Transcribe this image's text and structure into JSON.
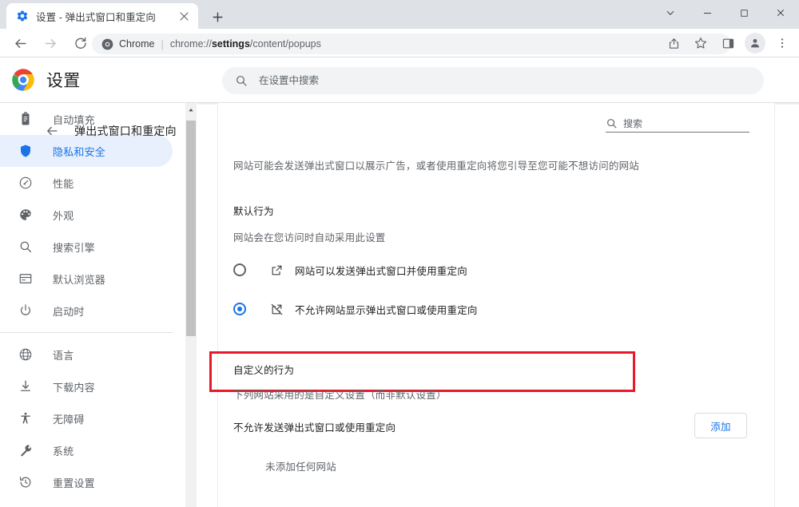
{
  "window": {
    "controls": [
      {
        "name": "tab-search-button",
        "glyph": "chevron-down-icon"
      },
      {
        "name": "minimize-button",
        "glyph": "minimize-icon"
      },
      {
        "name": "maximize-button",
        "glyph": "maximize-icon"
      },
      {
        "name": "close-button",
        "glyph": "close-icon"
      }
    ]
  },
  "tabstrip": {
    "tab": {
      "title": "设置 - 弹出式窗口和重定向",
      "favicon": "settings-gear-icon",
      "close_label": "×"
    },
    "new_tab_label": "+"
  },
  "toolbar": {
    "back_label": "←",
    "forward_label": "→",
    "reload_label": "⟳",
    "omnibox": {
      "icon": "chrome-icon",
      "scheme_label": "Chrome",
      "separator": "|",
      "url_prefix": "chrome://",
      "url_bold": "settings",
      "url_suffix": "/content/popups",
      "full_url": "chrome://settings/content/popups"
    },
    "right_icons": [
      {
        "name": "share-icon"
      },
      {
        "name": "bookmark-star-icon"
      },
      {
        "name": "side-panel-icon"
      },
      {
        "name": "profile-avatar-icon"
      },
      {
        "name": "more-menu-icon"
      }
    ]
  },
  "settings_header": {
    "logo": "chrome-logo",
    "title": "设置",
    "search": {
      "icon": "search-icon",
      "placeholder": "在设置中搜索",
      "value": ""
    }
  },
  "sidebar": {
    "groups": [
      {
        "items": [
          {
            "label": "自动填充",
            "icon": "clipboard-icon",
            "selected": false
          },
          {
            "label": "隐私和安全",
            "icon": "shield-icon",
            "selected": true
          },
          {
            "label": "性能",
            "icon": "speedometer-icon",
            "selected": false
          },
          {
            "label": "外观",
            "icon": "palette-icon",
            "selected": false
          },
          {
            "label": "搜索引擎",
            "icon": "search-icon",
            "selected": false
          },
          {
            "label": "默认浏览器",
            "icon": "browser-window-icon",
            "selected": false
          },
          {
            "label": "启动时",
            "icon": "power-icon",
            "selected": false
          }
        ]
      },
      {
        "items": [
          {
            "label": "语言",
            "icon": "globe-icon",
            "selected": false
          },
          {
            "label": "下载内容",
            "icon": "download-icon",
            "selected": false
          },
          {
            "label": "无障碍",
            "icon": "accessibility-icon",
            "selected": false
          },
          {
            "label": "系统",
            "icon": "wrench-icon",
            "selected": false
          },
          {
            "label": "重置设置",
            "icon": "history-restore-icon",
            "selected": false
          }
        ]
      }
    ],
    "scrollbar": {
      "name": "sidebar-scrollbar"
    }
  },
  "main": {
    "back_label": "←",
    "page_title": "弹出式窗口和重定向",
    "inline_search": {
      "icon": "search-icon",
      "placeholder": "搜索",
      "value": ""
    },
    "description": "网站可能会发送弹出式窗口以展示广告，或者使用重定向将您引导至您可能不想访问的网站",
    "default_behavior": {
      "heading": "默认行为",
      "subtext": "网站会在您访问时自动采用此设置",
      "options": [
        {
          "label": "网站可以发送弹出式窗口并使用重定向",
          "icon": "popup-allowed-icon",
          "selected": false,
          "highlighted": true
        },
        {
          "label": "不允许网站显示弹出式窗口或使用重定向",
          "icon": "popup-blocked-icon",
          "selected": true,
          "highlighted": false
        }
      ]
    },
    "custom_behavior": {
      "heading": "自定义的行为",
      "subtext": "下列网站采用的是自定义设置（而非默认设置）",
      "block_list": {
        "label": "不允许发送弹出式窗口或使用重定向",
        "add_button": "添加",
        "empty_text": "未添加任何网站"
      }
    }
  },
  "colors": {
    "accent": "#1a73e8",
    "selected_nav_bg": "#e8f0fe",
    "highlight_box": "#e8182a",
    "toolbar_bg": "#dee1e6",
    "omnibox_bg": "#f1f3f4",
    "text_primary": "#202124",
    "text_secondary": "#5f6368"
  }
}
